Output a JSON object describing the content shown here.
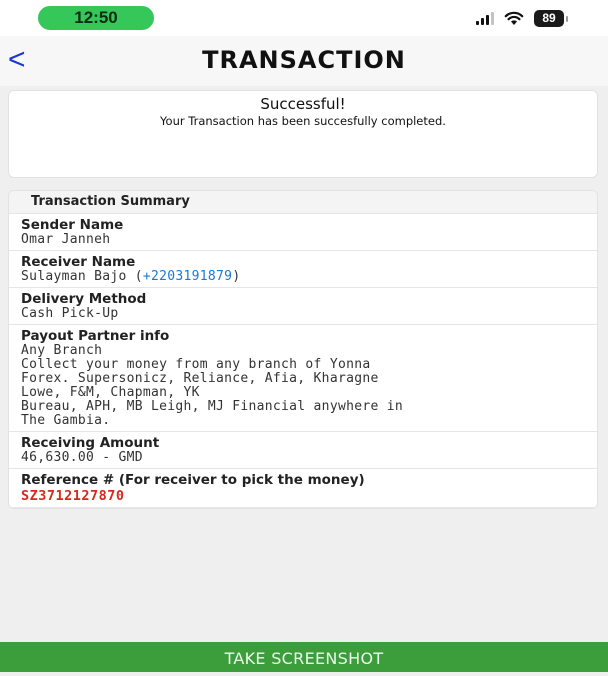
{
  "status_bar": {
    "time": "12:50",
    "battery": "89",
    "icons": [
      "signal-icon",
      "wifi-icon",
      "battery-icon"
    ]
  },
  "header": {
    "back_label": "<",
    "title": "TRANSACTION"
  },
  "success": {
    "title": "Successful!",
    "message": "Your Transaction has been succesfully completed."
  },
  "summary": {
    "title": "Transaction Summary",
    "sender": {
      "label": "Sender Name",
      "value": "Omar Janneh"
    },
    "receiver": {
      "label": "Receiver Name",
      "name": "Sulayman Bajo (",
      "phone": "+2203191879",
      "suffix": ")"
    },
    "delivery": {
      "label": "Delivery Method",
      "value": "Cash Pick-Up"
    },
    "payout": {
      "label": "Payout Partner info",
      "lines": [
        "Any Branch",
        "Collect your money from any branch of Yonna",
        "Forex. Supersonicz, Reliance, Afia, Kharagne",
        "Lowe, F&M, Chapman, YK",
        "Bureau, APH, MB Leigh, MJ Financial anywhere in",
        "The Gambia."
      ]
    },
    "amount": {
      "label": "Receiving Amount",
      "value": "46,630.00 - GMD"
    },
    "reference": {
      "label": "Reference # (For receiver to pick the money)",
      "value": "SZ3712127870"
    }
  },
  "footer": {
    "button_label": "TAKE SCREENSHOT"
  },
  "colors": {
    "time_pill": "#35c759",
    "back_arrow": "#1a35d4",
    "phone_link": "#1a78d6",
    "reference": "#d6281d",
    "button": "#3b9e3b"
  }
}
